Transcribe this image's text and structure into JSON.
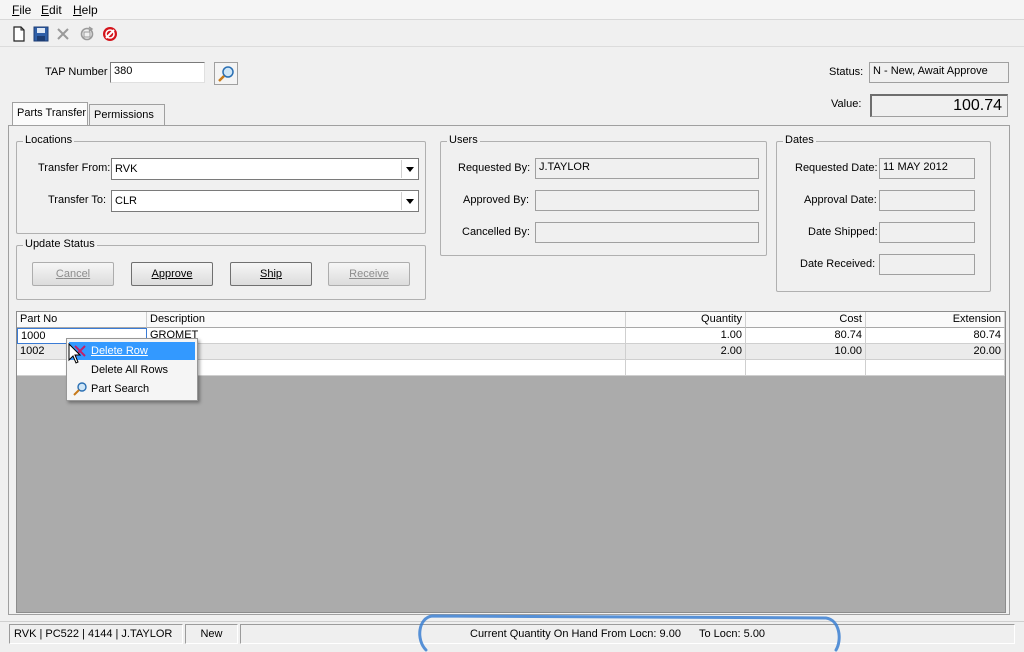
{
  "menu": {
    "file": {
      "accel": "F",
      "rest": "ile"
    },
    "edit": {
      "accel": "E",
      "rest": "dit"
    },
    "help": {
      "accel": "H",
      "rest": "elp"
    }
  },
  "toolbar": {
    "icons": [
      "new-document-icon",
      "save-icon",
      "delete-icon",
      "refresh-icon",
      "stop-icon"
    ]
  },
  "header": {
    "tap_label": "TAP Number",
    "tap_value": "380",
    "status_label": "Status:",
    "status_value": "N - New, Await Approve",
    "value_label": "Value:",
    "value_value": "100.74"
  },
  "tabs": [
    "Parts Transfer",
    "Permissions"
  ],
  "locations": {
    "title": "Locations",
    "from_label": "Transfer From:",
    "from_value": "RVK",
    "to_label": "Transfer To:",
    "to_value": "CLR"
  },
  "update_status": {
    "title": "Update Status",
    "cancel": {
      "accel": "C",
      "rest": "ancel"
    },
    "approve": {
      "accel": "A",
      "rest": "pprove"
    },
    "ship": {
      "accel": "S",
      "rest": "hip"
    },
    "receive": {
      "accel": "R",
      "rest": "eceive"
    }
  },
  "users": {
    "title": "Users",
    "requested_label": "Requested By:",
    "requested_value": "J.TAYLOR",
    "approved_label": "Approved By:",
    "approved_value": "",
    "cancelled_label": "Cancelled By:",
    "cancelled_value": ""
  },
  "dates": {
    "title": "Dates",
    "requested_label": "Requested Date:",
    "requested_value": "11 MAY 2012",
    "approval_label": "Approval Date:",
    "approval_value": "",
    "shipped_label": "Date Shipped:",
    "shipped_value": "",
    "received_label": "Date Received:",
    "received_value": ""
  },
  "grid": {
    "columns": [
      "Part No",
      "Description",
      "Quantity",
      "Cost",
      "Extension"
    ],
    "rows": [
      {
        "part": "1000",
        "desc": "GROMET",
        "qty": "1.00",
        "cost": "80.74",
        "ext": "80.74"
      },
      {
        "part": "1002",
        "desc": "",
        "qty": "2.00",
        "cost": "10.00",
        "ext": "20.00"
      }
    ]
  },
  "context_menu": {
    "delete_row": "Delete Row",
    "delete_all_rows": "Delete All Rows",
    "part_search": "Part Search"
  },
  "statusbar": {
    "info": "RVK | PC522 | 4144 | J.TAYLOR",
    "mode": "New",
    "qty_from": "Current Quantity On Hand From Locn: 9.00",
    "qty_to": "To Locn: 5.00"
  }
}
